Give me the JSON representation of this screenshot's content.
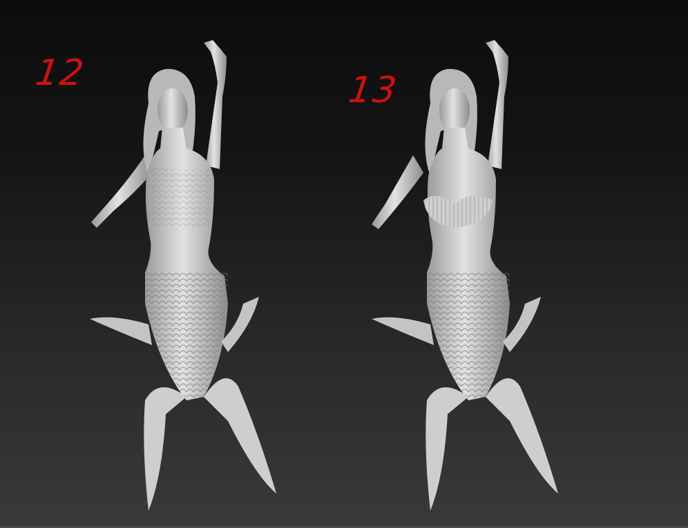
{
  "labels": {
    "left": "12",
    "right": "13"
  },
  "colors": {
    "label": "#d01010",
    "model": "#d4d4d4",
    "background_top": "#0c0c0c",
    "background_bottom": "#3a3a3a"
  }
}
